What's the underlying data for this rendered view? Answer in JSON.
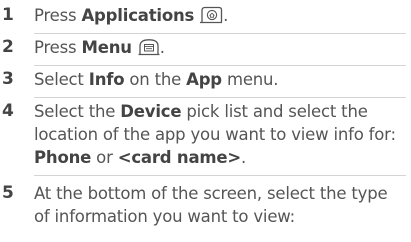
{
  "steps": [
    {
      "num": "1",
      "pre": "Press ",
      "b1": "Applications",
      "post": ".",
      "icon": "applications-button-icon"
    },
    {
      "num": "2",
      "pre": "Press ",
      "b1": "Menu",
      "post": ".",
      "icon": "menu-button-icon"
    },
    {
      "num": "3",
      "pre": "Select ",
      "b1": "Info",
      "mid": " on the ",
      "b2": "App",
      "post": " menu."
    },
    {
      "num": "4",
      "pre": "Select the ",
      "b1": "Device",
      "mid": " pick list and select the location of the app you want to view info for: ",
      "b2": "Phone",
      "mid2": " or ",
      "b3": "<card name>",
      "post": "."
    },
    {
      "num": "5",
      "text": "At the bottom of the screen, select the type of information you want to view:"
    }
  ]
}
